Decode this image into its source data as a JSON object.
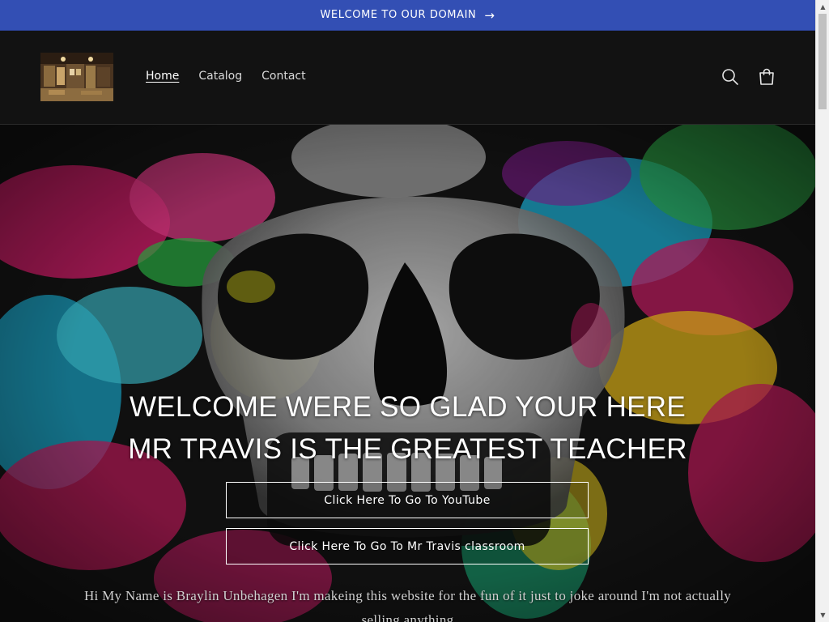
{
  "announcement": {
    "text": "WELCOME TO OUR DOMAIN",
    "arrow": "→"
  },
  "header": {
    "logo_alt": "store-logo",
    "nav": [
      {
        "label": "Home",
        "active": true
      },
      {
        "label": "Catalog",
        "active": false
      },
      {
        "label": "Contact",
        "active": false
      }
    ],
    "icons": [
      "search-icon",
      "cart-icon"
    ]
  },
  "hero": {
    "title": "WELCOME WERE SO GLAD YOUR HERE MR TRAVIS IS THE GREATEST TEACHER",
    "button_youtube": "Click Here To Go To YouTube",
    "button_classroom": "Click Here To Go To Mr Travis classroom",
    "text": "Hi My Name is Braylin Unbehagen I'm makeing this website for the fun of it just to joke around I'm not actually selling anything"
  },
  "colors": {
    "announcement_bg": "#334fb4",
    "header_bg": "#121212",
    "text": "#ffffff"
  }
}
